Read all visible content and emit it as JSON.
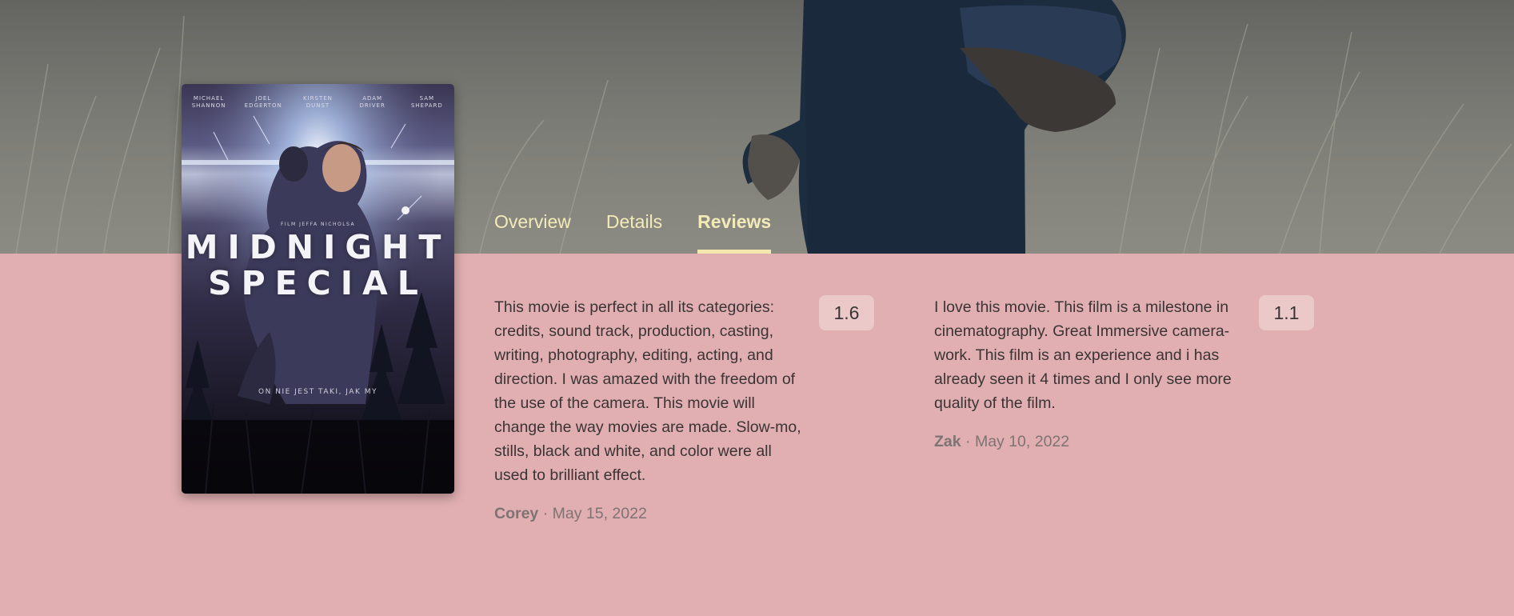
{
  "poster": {
    "cast": [
      "MICHAEL\nSHANNON",
      "JOEL\nEDGERTON",
      "KIRSTEN\nDUNST",
      "ADAM\nDRIVER",
      "SAM\nSHEPARD"
    ],
    "credit": "FILM JEFFA NICHOLSA",
    "title_line1": "MIDNIGHT",
    "title_line2": "SPECIAL",
    "tagline": "ON NIE JEST TAKI, JAK MY"
  },
  "tabs": [
    {
      "label": "Overview",
      "active": false
    },
    {
      "label": "Details",
      "active": false
    },
    {
      "label": "Reviews",
      "active": true
    }
  ],
  "reviews": [
    {
      "text": "This movie is perfect in all its categories: credits, sound track, production, casting, writing, photography, editing, acting, and direction. I was amazed with the freedom of the use of the camera. This movie will change the way movies are made. Slow-mo, stills, black and white, and color were all used to brilliant effect.",
      "author": "Corey",
      "separator": "·",
      "date": "May 15, 2022",
      "rating": "1.6"
    },
    {
      "text": "I love this movie. This film is a milestone in cinematography. Great Immersive camera-work. This film is an experience and i has already seen it 4 times and I only see more quality of the film.",
      "author": "Zak",
      "separator": "·",
      "date": "May 10, 2022",
      "rating": "1.1"
    }
  ],
  "colors": {
    "content_bg": "#e1afb1",
    "tab_text": "#f2eab8",
    "rating_bg": "#ebc9c9"
  }
}
